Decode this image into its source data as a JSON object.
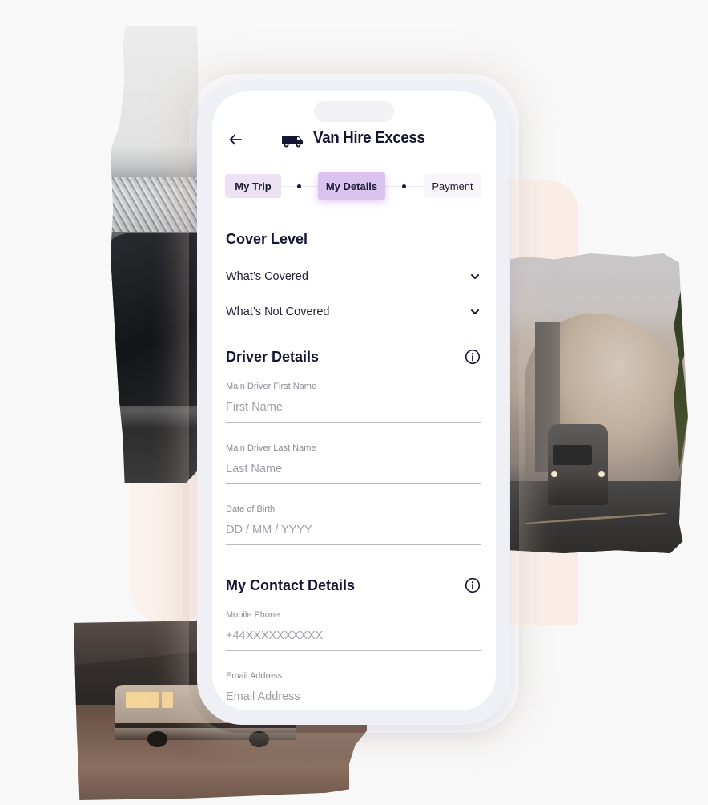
{
  "app": {
    "title": "Van Hire Excess",
    "back_label": "Back",
    "brand_icon": "van-icon"
  },
  "steps": [
    {
      "label": "My Trip",
      "state": "completed"
    },
    {
      "label": "My Details",
      "state": "active"
    },
    {
      "label": "Payment",
      "state": "upcoming"
    }
  ],
  "cover_level": {
    "title": "Cover Level",
    "accordions": [
      {
        "label": "What’s Covered",
        "icon": "chevron-down-icon",
        "expanded": false
      },
      {
        "label": "What’s Not Covered",
        "icon": "chevron-down-icon",
        "expanded": false
      }
    ]
  },
  "driver_details": {
    "title": "Driver Details",
    "info_icon": "info-icon",
    "fields": [
      {
        "label": "Main Driver First Name",
        "placeholder": "First Name",
        "value": ""
      },
      {
        "label": "Main Driver Last Name",
        "placeholder": "Last Name",
        "value": ""
      },
      {
        "label": "Date of Birth",
        "placeholder": "DD / MM / YYYY",
        "value": ""
      }
    ]
  },
  "contact_details": {
    "title": "My Contact Details",
    "info_icon": "info-icon",
    "fields": [
      {
        "label": "Mobile Phone",
        "placeholder": "+44XXXXXXXXXX",
        "value": ""
      },
      {
        "label": "Email Address",
        "placeholder": "Email Address",
        "value": ""
      }
    ]
  },
  "colors": {
    "text_primary": "#141433",
    "step_completed": "#ede2f4",
    "step_active": "#dbc3ef",
    "step_upcoming": "#f8f6fb",
    "accent_peach": "#f9ebe4"
  }
}
